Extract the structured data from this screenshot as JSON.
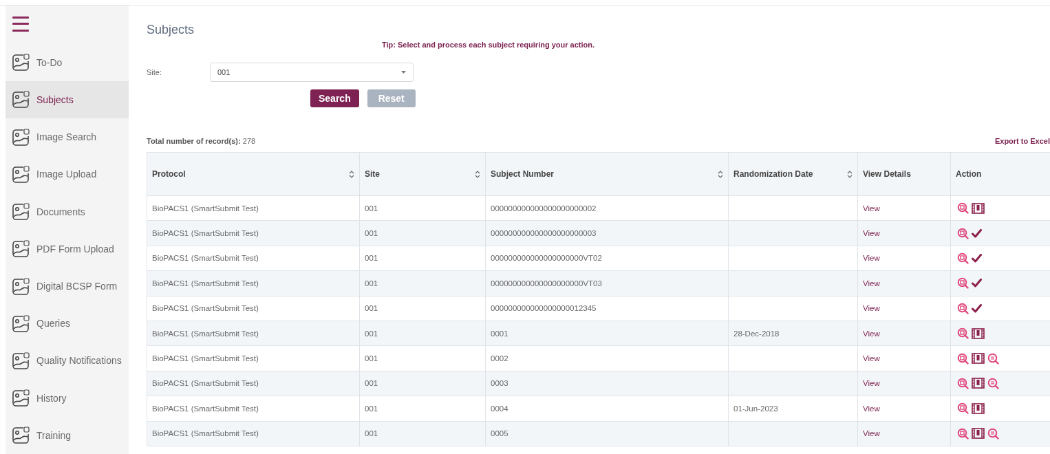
{
  "sidebar": {
    "items": [
      {
        "label": "To-Do",
        "selected": false
      },
      {
        "label": "Subjects",
        "selected": true
      },
      {
        "label": "Image Search",
        "selected": false
      },
      {
        "label": "Image Upload",
        "selected": false
      },
      {
        "label": "Documents",
        "selected": false
      },
      {
        "label": "PDF Form Upload",
        "selected": false
      },
      {
        "label": "Digital BCSP Form",
        "selected": false
      },
      {
        "label": "Queries",
        "selected": false
      },
      {
        "label": "Quality Notifications",
        "selected": false
      },
      {
        "label": "History",
        "selected": false
      },
      {
        "label": "Training",
        "selected": false
      }
    ]
  },
  "page": {
    "title": "Subjects",
    "tip": "Tip: Select and process each subject requiring your action."
  },
  "filter": {
    "label": "Site:",
    "value": "001",
    "buttons": [
      {
        "label": "Search",
        "disabled": false
      },
      {
        "label": "Reset",
        "disabled": true
      }
    ]
  },
  "summary": {
    "label": "Total number of record(s):",
    "count": "278",
    "export": "Export to Excel"
  },
  "table": {
    "columns": [
      {
        "label": "Protocol",
        "sortable": true
      },
      {
        "label": "Site",
        "sortable": true
      },
      {
        "label": "Subject Number",
        "sortable": true
      },
      {
        "label": "Randomization Date",
        "sortable": true
      },
      {
        "label": "View Details"
      },
      {
        "label": "Action"
      }
    ],
    "rows": [
      {
        "protocol": "BioPACS1 (SmartSubmit Test)",
        "site": "001",
        "subject": "000000000000000000000002",
        "date": "",
        "view": "View",
        "actions": [
          {
            "kind": "review"
          },
          {
            "kind": "upload"
          }
        ]
      },
      {
        "protocol": "BioPACS1 (SmartSubmit Test)",
        "site": "001",
        "subject": "000000000000000000000003",
        "date": "",
        "view": "View",
        "actions": [
          {
            "kind": "review"
          },
          {
            "kind": "check"
          }
        ]
      },
      {
        "protocol": "BioPACS1 (SmartSubmit Test)",
        "site": "001",
        "subject": "000000000000000000000VT02",
        "date": "",
        "view": "View",
        "actions": [
          {
            "kind": "review"
          },
          {
            "kind": "check"
          }
        ]
      },
      {
        "protocol": "BioPACS1 (SmartSubmit Test)",
        "site": "001",
        "subject": "000000000000000000000VT03",
        "date": "",
        "view": "View",
        "actions": [
          {
            "kind": "review"
          },
          {
            "kind": "check"
          }
        ]
      },
      {
        "protocol": "BioPACS1 (SmartSubmit Test)",
        "site": "001",
        "subject": "000000000000000000012345",
        "date": "",
        "view": "View",
        "actions": [
          {
            "kind": "review"
          },
          {
            "kind": "check"
          }
        ]
      },
      {
        "protocol": "BioPACS1 (SmartSubmit Test)",
        "site": "001",
        "subject": "0001",
        "date": "28-Dec-2018",
        "view": "View",
        "actions": [
          {
            "kind": "review"
          },
          {
            "kind": "upload"
          }
        ]
      },
      {
        "protocol": "BioPACS1 (SmartSubmit Test)",
        "site": "001",
        "subject": "0002",
        "date": "",
        "view": "View",
        "actions": [
          {
            "kind": "review"
          },
          {
            "kind": "upload"
          },
          {
            "kind": "query"
          }
        ]
      },
      {
        "protocol": "BioPACS1 (SmartSubmit Test)",
        "site": "001",
        "subject": "0003",
        "date": "",
        "view": "View",
        "actions": [
          {
            "kind": "review"
          },
          {
            "kind": "upload"
          },
          {
            "kind": "query"
          }
        ]
      },
      {
        "protocol": "BioPACS1 (SmartSubmit Test)",
        "site": "001",
        "subject": "0004",
        "date": "01-Jun-2023",
        "view": "View",
        "actions": [
          {
            "kind": "review"
          },
          {
            "kind": "upload"
          }
        ]
      },
      {
        "protocol": "BioPACS1 (SmartSubmit Test)",
        "site": "001",
        "subject": "0005",
        "date": "",
        "view": "View",
        "actions": [
          {
            "kind": "review"
          },
          {
            "kind": "upload"
          },
          {
            "kind": "query"
          }
        ]
      }
    ]
  }
}
